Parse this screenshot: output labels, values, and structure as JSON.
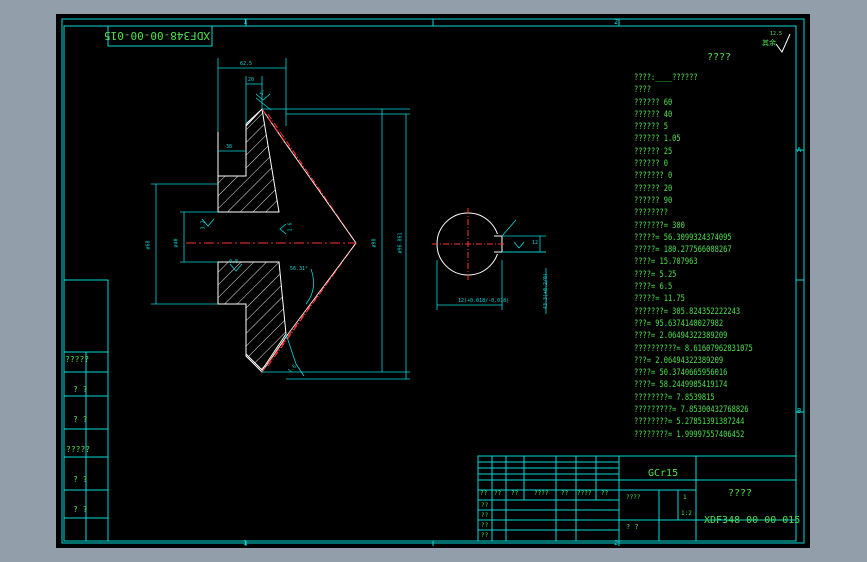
{
  "colors": {
    "frame": "#00d8d8",
    "dimension": "#00d8d8",
    "outline": "#ffffff",
    "hatch": "#ffffff",
    "centerline": "#ff3030",
    "text": "#4fe04f",
    "background": "#000000",
    "surround": "#929ea9"
  },
  "drawing_number_flipped": "XDF348-00-00-015",
  "zone_labels": {
    "top": [
      "1",
      "2"
    ],
    "bottom": [
      "1",
      "2"
    ],
    "right": [
      "A",
      "B"
    ]
  },
  "roughness_note": {
    "symbol": "rough-surface-icon",
    "value": "12.5",
    "label": "其余"
  },
  "params_title": "????",
  "params": [
    "????:____??????",
    "????",
    "?????? 60",
    "?????? 40",
    "?????? 5",
    "?????? 1.05",
    "??????  25",
    "?????? 0",
    "??????? 0",
    "?????? 20",
    "?????? 90",
    "????????",
    "???????= 300",
    "?????= 56.3099324374095",
    "?????= 180.277566008267",
    "????= 15.707963",
    "????= 5.25",
    "????= 6.5",
    "?????= 11.75",
    "???????= 305.824352222243",
    "???= 95.6374140027982",
    "????= 2.06494322389209",
    "??????????= 8.61607962831075",
    "???= 2.06494322389209",
    "????= 50.3740665956016",
    "????= 58.2449985419174",
    "????????= 7.8539815",
    "?????????= 7.85300432768826",
    "????????= 5.27851391387244",
    "????????= 1.99997557406452"
  ],
  "left_strip_labels": [
    "?????",
    "?  ?",
    "?  ?",
    "?????",
    "?  ?",
    "?  ?"
  ],
  "title_block": {
    "material": "GCr15",
    "part_name": "????",
    "drawing_no": "XDF348-00-00-015",
    "scale_label": "????",
    "sheet_qty": "1",
    "scale_value": "1:2",
    "sheet_of": "?  ?",
    "row_labels": [
      "??",
      "??",
      "??",
      "????",
      "??",
      "????",
      "??"
    ],
    "sign_rows": [
      "??",
      "??",
      "??",
      "??"
    ]
  },
  "dimensions": {
    "top_length": "62.5",
    "hub_length": "20",
    "flange_thk": "38",
    "bore_dia": "ø40",
    "bore_tol": "ø40(+0.025/0)",
    "hub_dia": "ø68",
    "outer_dia": "ø98",
    "pitch_dia": "ø96.861",
    "face_angle": "56.31°",
    "keyway_w": "12",
    "keyway_depth": "43.3(+0.2/0)",
    "keyway_w_tol": "12(+0.018/-0.018)",
    "roughness_a": "3.2",
    "roughness_b": "1.6",
    "roughness_c": "0.8",
    "angle_small": "5°",
    "chamfer": "1.6"
  }
}
